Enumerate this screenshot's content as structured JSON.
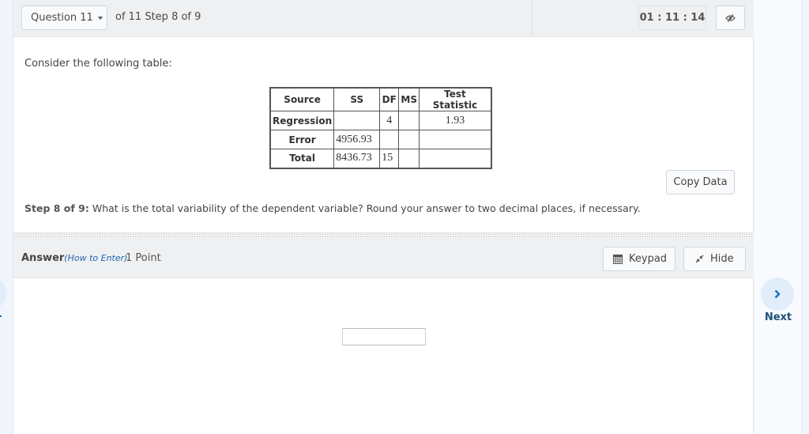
{
  "header": {
    "question_select": "Question 11",
    "step_info": "of 11 Step 8 of 9",
    "timer": "01 : 11 : 14",
    "visibility_icon": "eye-slash-icon"
  },
  "content": {
    "prompt": "Consider the following table:",
    "table": {
      "headers": [
        "Source",
        "SS",
        "DF",
        "MS",
        "Test Statistic"
      ],
      "rows": [
        {
          "source": "Regression",
          "ss": "",
          "df": "4",
          "ms": "",
          "test_statistic": "1.93"
        },
        {
          "source": "Error",
          "ss": "4956.93",
          "df": "",
          "ms": "",
          "test_statistic": ""
        },
        {
          "source": "Total",
          "ss": "8436.73",
          "df": "15",
          "ms": "",
          "test_statistic": ""
        }
      ]
    },
    "copy_data_label": "Copy Data",
    "question_prefix": "Step 8 of 9:",
    "question_text": " What is the total variability of the dependent variable? Round your answer to two decimal places, if necessary."
  },
  "answer": {
    "label": "Answer",
    "how_to_enter": "(How to Enter)",
    "points": "1 Point",
    "keypad_label": "Keypad",
    "hide_label": "Hide",
    "input_value": ""
  },
  "nav": {
    "next_label": "Next"
  }
}
